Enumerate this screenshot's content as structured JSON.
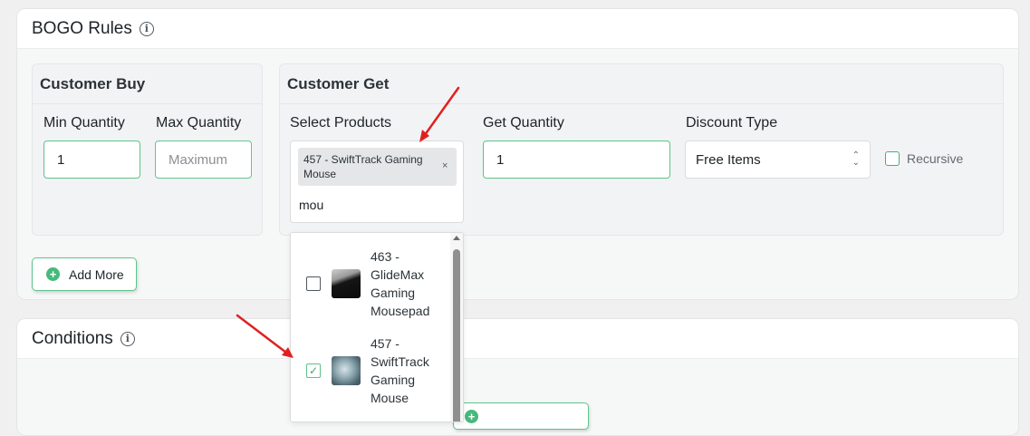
{
  "bogo": {
    "title": "BOGO Rules",
    "info_icon": "info-icon",
    "customer_buy": {
      "title": "Customer Buy",
      "min_label": "Min Quantity",
      "min_value": "1",
      "max_label": "Max Quantity",
      "max_placeholder": "Maximum"
    },
    "customer_get": {
      "title": "Customer Get",
      "products_label": "Select Products",
      "selected_chip": "457 - SwiftTrack Gaming Mouse",
      "chip_remove": "×",
      "search_text": "mou",
      "get_qty_label": "Get Quantity",
      "get_qty_value": "1",
      "discount_label": "Discount Type",
      "discount_value": "Free Items",
      "recursive_label": "Recursive"
    },
    "dropdown": {
      "options": [
        {
          "lines": [
            "463 -",
            "GlideMax",
            "Gaming",
            "Mousepad"
          ],
          "checked": false,
          "thumb": "mousepad-thumbnail"
        },
        {
          "lines": [
            "457 -",
            "SwiftTrack",
            "Gaming",
            "Mouse"
          ],
          "checked": true,
          "thumb": "mouse-thumbnail"
        }
      ]
    },
    "add_more_label": "Add More"
  },
  "conditions": {
    "title": "Conditions",
    "info_icon": "info-icon"
  },
  "colors": {
    "accent": "#46b97c",
    "annotation_arrow": "#e02020"
  }
}
